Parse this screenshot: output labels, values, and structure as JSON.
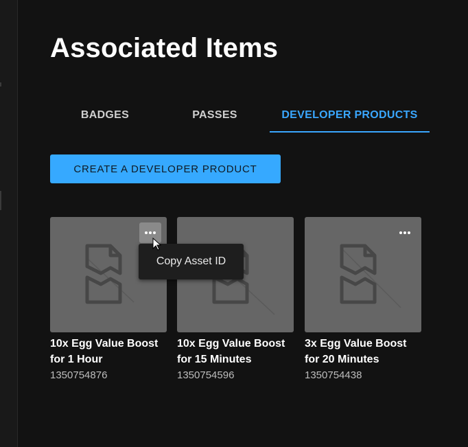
{
  "page": {
    "title": "Associated Items"
  },
  "tabs": [
    {
      "label": "BADGES"
    },
    {
      "label": "PASSES"
    },
    {
      "label": "DEVELOPER PRODUCTS",
      "active": true
    }
  ],
  "create_button": {
    "label": "CREATE A DEVELOPER PRODUCT"
  },
  "products": [
    {
      "name": "10x Egg Value Boost for 1 Hour",
      "id": "1350754876"
    },
    {
      "name": "10x Egg Value Boost for 15 Minutes",
      "id": "1350754596"
    },
    {
      "name": "3x Egg Value Boost for 20 Minutes",
      "id": "1350754438"
    }
  ],
  "context_menu": {
    "item": "Copy Asset ID"
  },
  "colors": {
    "background": "#121212",
    "accent": "#36a9ff",
    "tab_active": "#3aa7ff",
    "thumbnail": "#666666"
  },
  "icons": {
    "more": "more-horizontal-icon",
    "placeholder": "broken-image-placeholder-icon",
    "cursor": "mouse-pointer-icon"
  }
}
